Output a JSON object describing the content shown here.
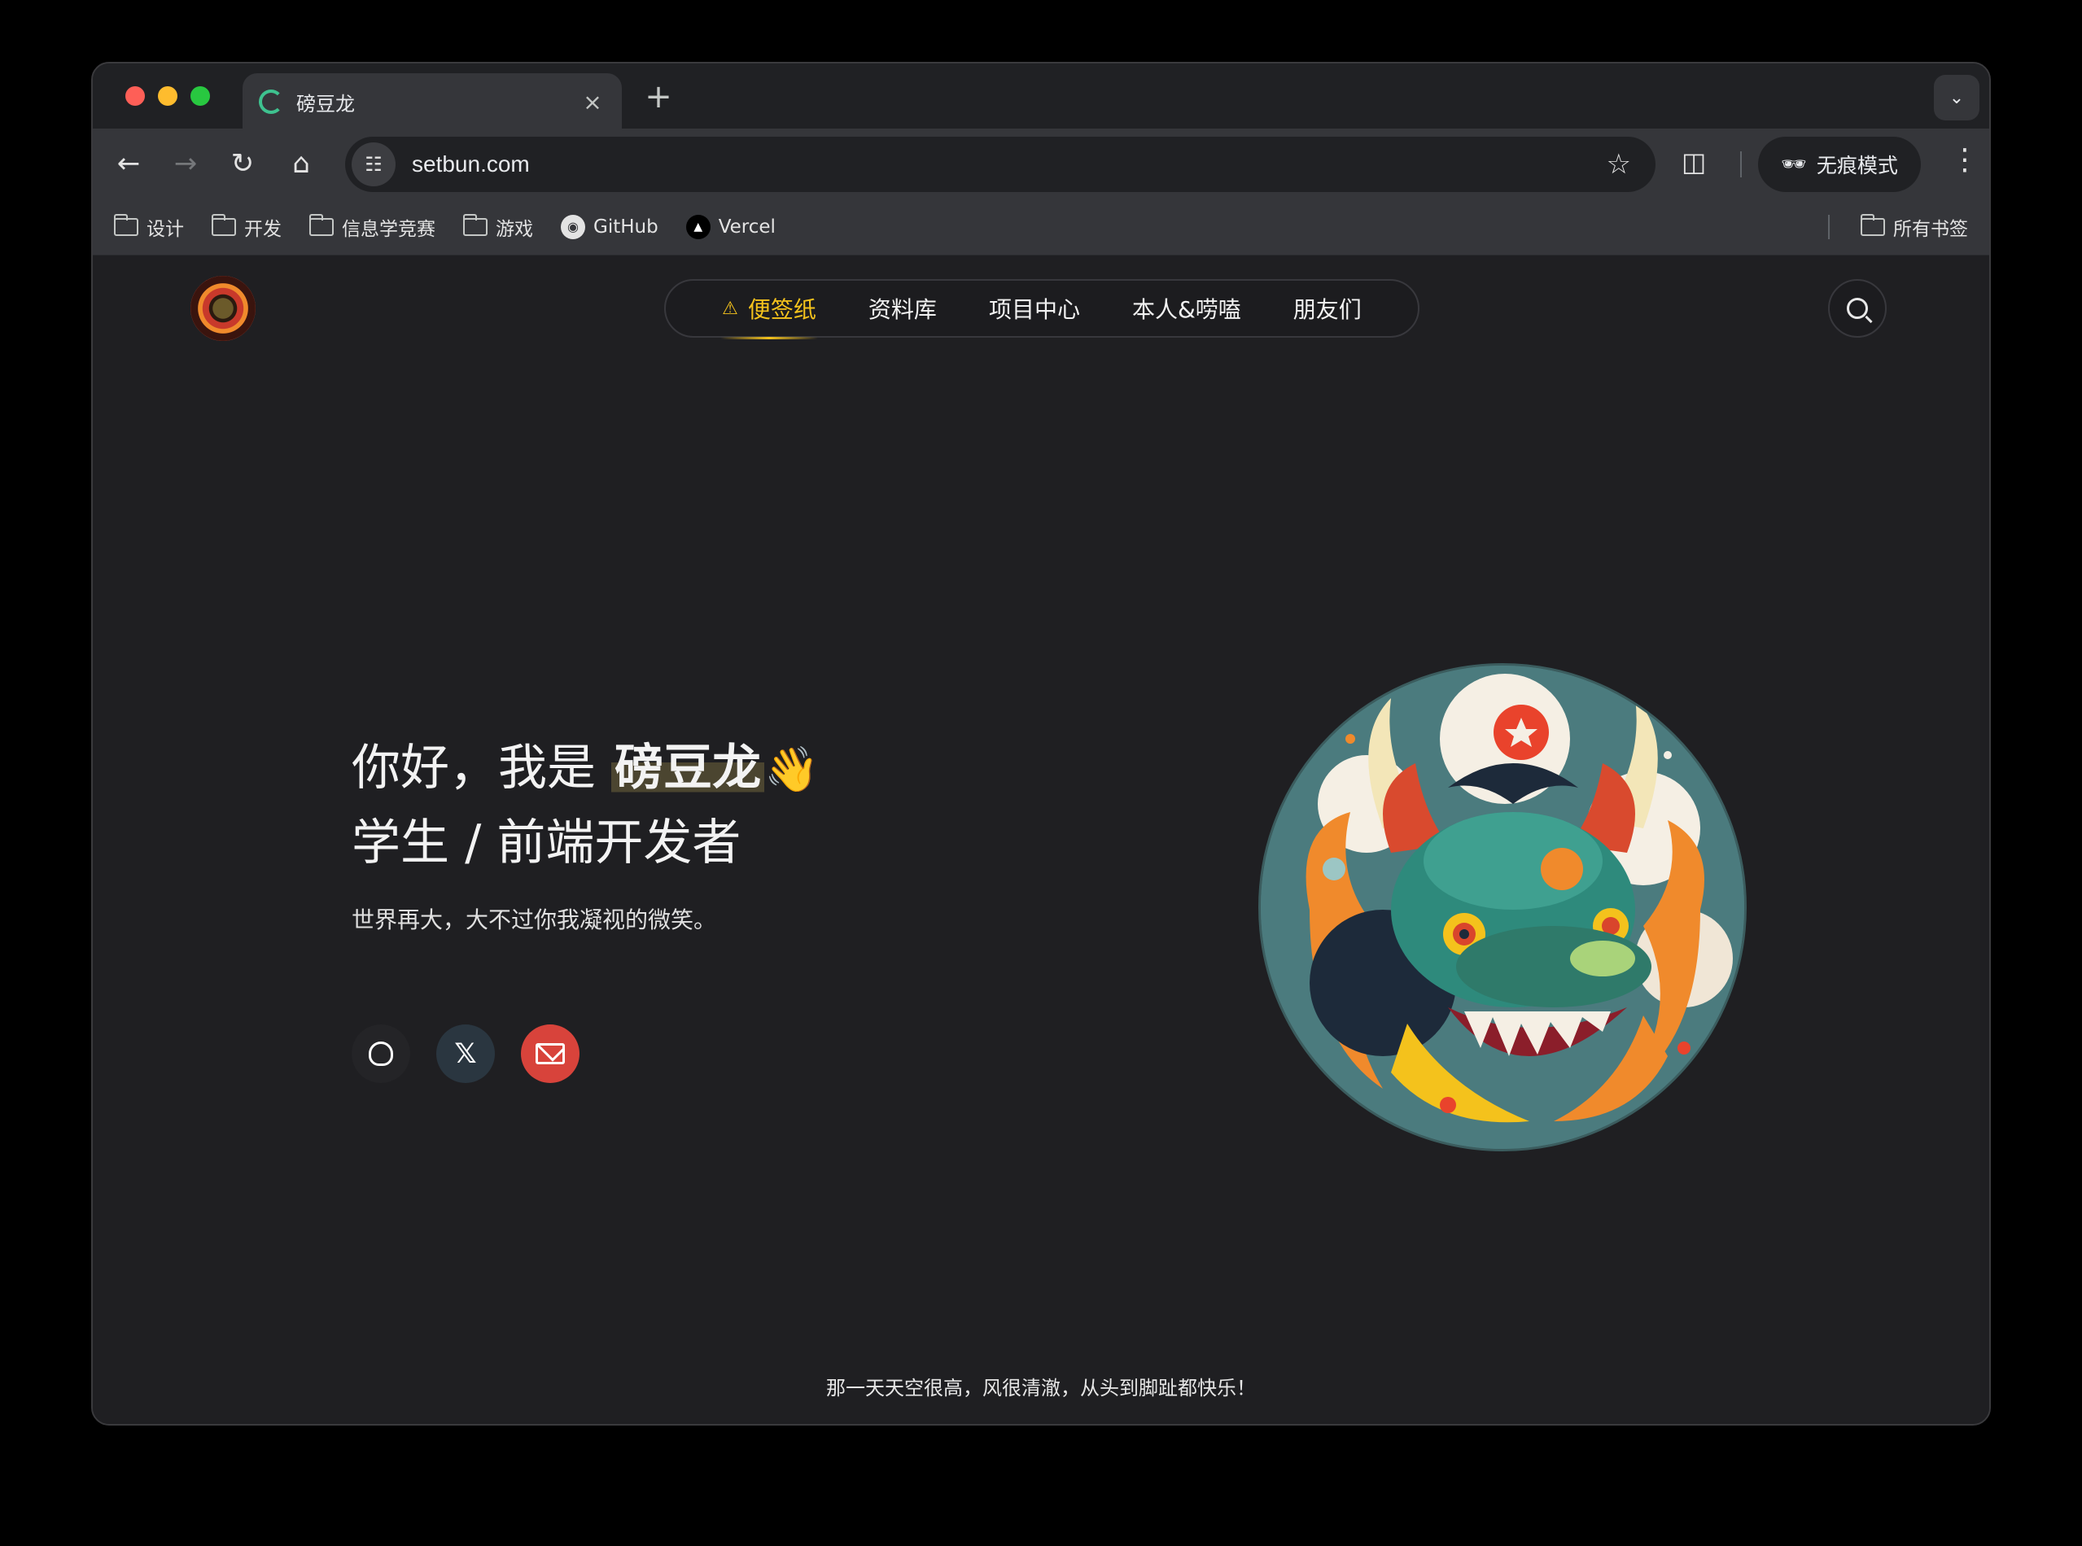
{
  "browser": {
    "tab_title": "磅豆龙",
    "new_tab": "+",
    "tab_close": "×",
    "url": "setbun.com",
    "incognito_label": "无痕模式",
    "bookmarks": [
      {
        "label": "设计",
        "type": "folder"
      },
      {
        "label": "开发",
        "type": "folder"
      },
      {
        "label": "信息学竞赛",
        "type": "folder"
      },
      {
        "label": "游戏",
        "type": "folder"
      },
      {
        "label": "GitHub",
        "type": "link"
      },
      {
        "label": "Vercel",
        "type": "link"
      }
    ],
    "all_bookmarks": "所有书签"
  },
  "site": {
    "nav": [
      {
        "label": "便签纸",
        "active": true
      },
      {
        "label": "资料库",
        "active": false
      },
      {
        "label": "项目中心",
        "active": false
      },
      {
        "label": "本人&唠嗑",
        "active": false
      },
      {
        "label": "朋友们",
        "active": false
      }
    ],
    "hero": {
      "greeting": "你好，我是 ",
      "name": "磅豆龙",
      "wave": "👋",
      "subtitle": "学生 / 前端开发者",
      "motto": "世界再大，大不过你我凝视的微笑。"
    },
    "socials": [
      {
        "name": "github",
        "icon": "github-icon"
      },
      {
        "name": "x",
        "icon": "x-icon",
        "glyph": "𝕏"
      },
      {
        "name": "email",
        "icon": "mail-icon"
      }
    ],
    "tagline": "那一天天空很高，风很清澈，从头到脚趾都快乐！",
    "colors": {
      "accent": "#f4c21c",
      "background": "#1f1f22",
      "mail": "#d8433b"
    }
  }
}
